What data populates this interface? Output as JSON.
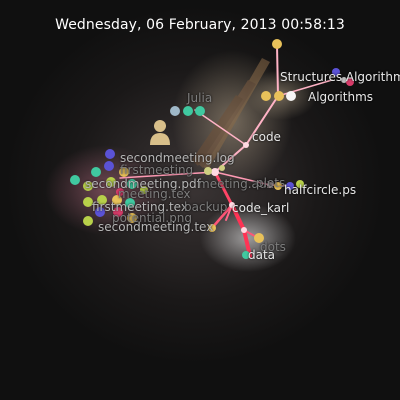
{
  "timestamp": "Wednesday, 06 February, 2013 00:58:13",
  "user": {
    "name": "Julia",
    "icon": "user-icon"
  },
  "directories": {
    "algorithms": "Algorithms",
    "structures_algorithms": "Structures Algorithm",
    "code": "code",
    "code_karl": "code_karl",
    "plots": "plots",
    "data": "data",
    "dots": "dots"
  },
  "files": {
    "halfcircle": "halfcircle.ps",
    "secondmeeting_log": "secondmeeting.log",
    "firstmeeting": "firstmeeting",
    "secondmeeting_pdf": "secondmeeting.pdf",
    "meeting_aux": "meeting.aux",
    "meeting_tex": "meeting.tex",
    "firstmeeting_tex": "firstmeeting.tex",
    "backup": "backup",
    "potential": "potential.png",
    "secondmeeting_tex": "secondmeeting.tex"
  },
  "colors": {
    "background": "#101010",
    "label": "#e8e8e8",
    "edge": "#ff6a8a",
    "edge_active": "#ff2244",
    "user_avatar": "#d8bf8a"
  }
}
